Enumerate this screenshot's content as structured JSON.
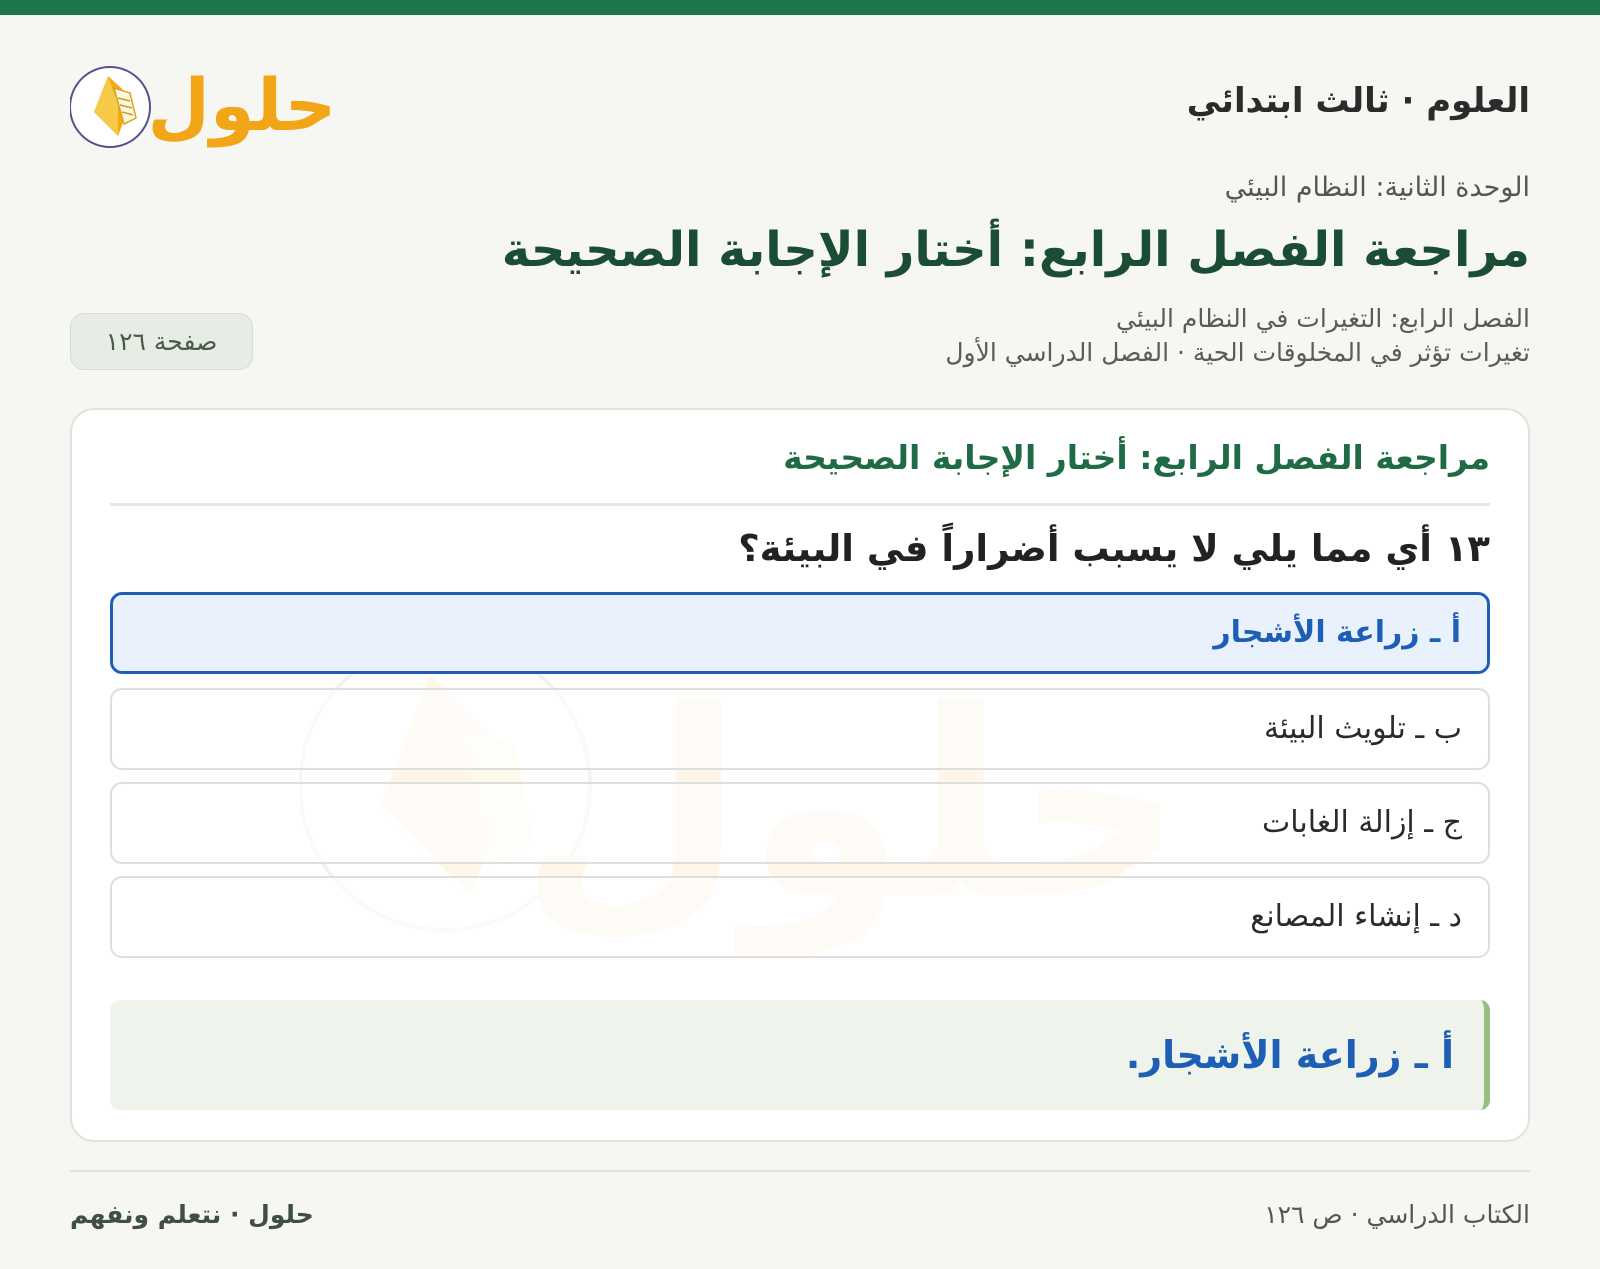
{
  "header": {
    "subject": "العلوم · ثالث ابتدائي",
    "logo_text": "حلول"
  },
  "unit": "الوحدة الثانية: النظام البيئي",
  "page_title": "مراجعة الفصل الرابع: أختار الإجابة الصحيحة",
  "chapter_line1": "الفصل الرابع: التغيرات في النظام البيئي",
  "chapter_line2": "تغيرات تؤثر في المخلوقات الحية · الفصل الدراسي الأول",
  "page_badge": "صفحة ١٢٦",
  "card": {
    "title": "مراجعة الفصل الرابع: أختار الإجابة الصحيحة",
    "question": "١٣ أي مما يلي لا يسبب أضراراً في البيئة؟",
    "options": [
      {
        "label": "أ ـ زراعة الأشجار",
        "selected": true
      },
      {
        "label": "ب ـ تلويث البيئة",
        "selected": false
      },
      {
        "label": "ج ـ إزالة الغابات",
        "selected": false
      },
      {
        "label": "د ـ إنشاء المصانع",
        "selected": false
      }
    ],
    "answer": "أ ـ زراعة الأشجار."
  },
  "footer": {
    "right": "الكتاب الدراسي · ص ١٢٦",
    "left": "حلول · نتعلم ونفهم"
  },
  "colors": {
    "brand_green": "#1f754b",
    "title_green": "#1a4d33",
    "selected_blue": "#1d5fb5",
    "logo_orange": "#f2a516"
  }
}
